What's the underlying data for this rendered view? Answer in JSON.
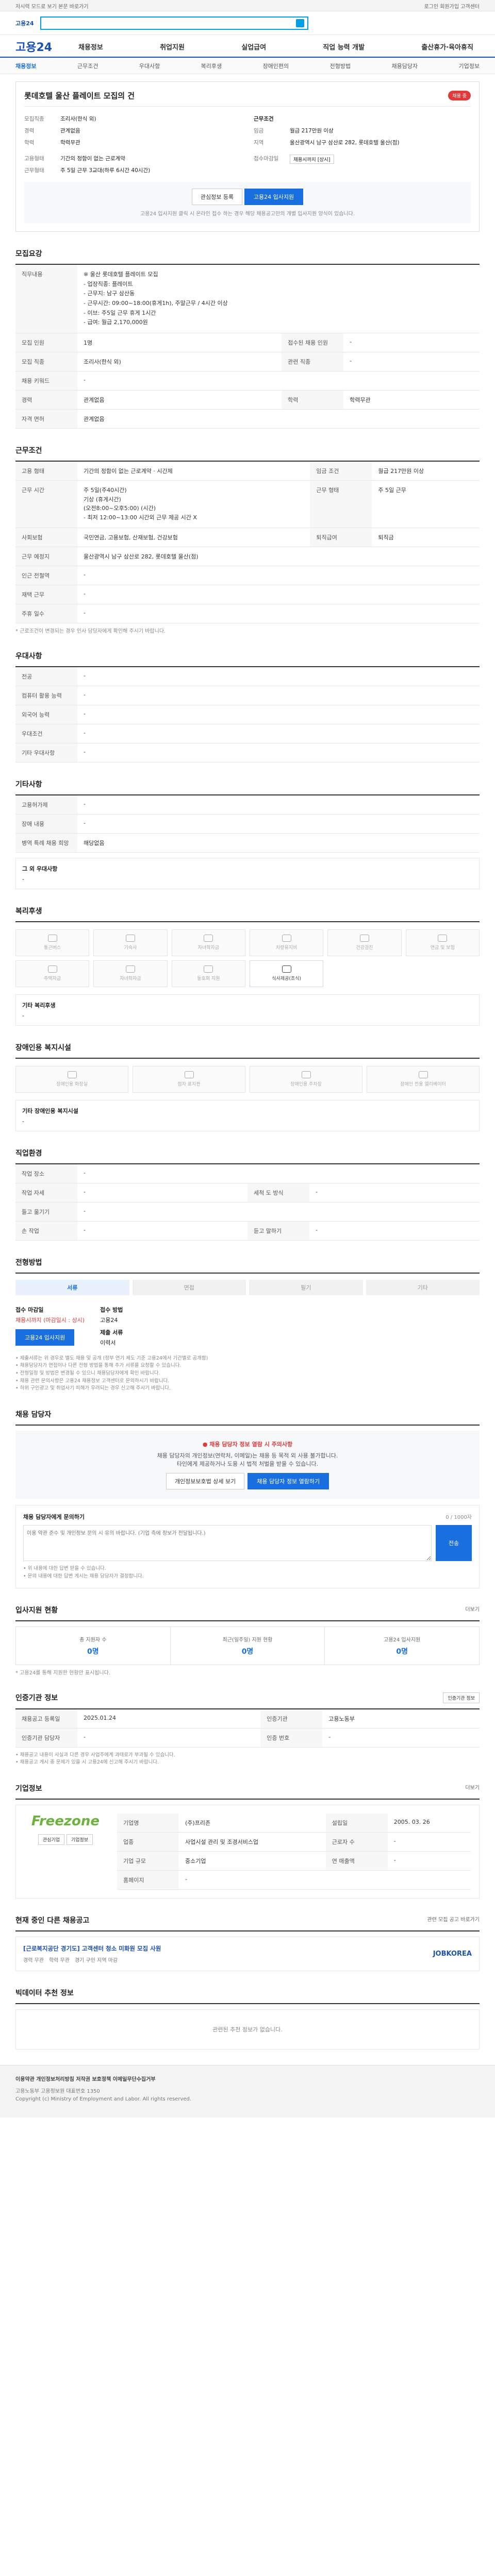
{
  "topbar": {
    "text": "저시력 모드로 보기  본문 바로가기",
    "right": "로그인  회원가입  고객센터"
  },
  "search": {
    "placeholder": "",
    "button": "검색"
  },
  "header": {
    "logo": "고용24",
    "menu": [
      "채용정보",
      "취업지원",
      "실업급여",
      "직업 능력 개발",
      "출산휴가·육아휴직"
    ]
  },
  "subnav": [
    "채용정보",
    "근무조건",
    "우대사항",
    "복리후생",
    "장애인편의",
    "전형방법",
    "채용담당자",
    "기업정보"
  ],
  "job": {
    "title": "롯데호텔 울산 플레이트 모집의 건",
    "badge": "채용 중",
    "rows": [
      {
        "k": "모집직종",
        "v": "조리사(한식 외)"
      },
      {
        "k": "경력",
        "v": "관계없음"
      },
      {
        "k": "학력",
        "v": "학력무관"
      }
    ],
    "rows_right": [
      {
        "k": "근무조건",
        "v": ""
      },
      {
        "k": "임금",
        "v": "월급 217만원 이상"
      },
      {
        "k": "지역",
        "v": "울산광역시 남구 삼산로 282, 롯데호텔 울산(점)"
      }
    ],
    "form": {
      "k": "고용형태",
      "v": "기간의 정함이 없는 근로계약"
    },
    "hours": {
      "k": "근무형태",
      "v": "주 5일 근무 3교대(하루 6시간 40시간)"
    },
    "deadline_label": "접수마감일",
    "deadline": "채용시까지 [상시]",
    "save_btn": "관심정보 등록",
    "apply_btn": "고용24 입사지원",
    "note": "고용24 입사지원 클릭 시 온라인 접수 하는 경우 해당 채용공고만의 개별 입사지원 양식이 있습니다."
  },
  "recruit": {
    "title": "모집요강",
    "duty_label": "직무내용",
    "duty": "※ 울산 롯데호텔 플레이트 모집\n- 업장직종: 플레이트\n- 근무지: 남구 삼산동\n- 근무시간: 09:00~18:00(휴게1h), 주말근무 / 4시간 이상\n- 이브: 주5일 근무 휴게 1시간\n- 급여: 월급 2,170,000원",
    "fields": [
      {
        "k": "모집 인원",
        "v": "1명",
        "k2": "접수된 채용 인원",
        "v2": "-"
      },
      {
        "k": "모집 직종",
        "v": "조리사(한식 외)",
        "k2": "관련 직종",
        "v2": "-"
      },
      {
        "k": "채용 키워드",
        "v": "-",
        "k2": "",
        "v2": ""
      },
      {
        "k": "경력",
        "v": "관계없음",
        "k2": "학력",
        "v2": "학력무관"
      },
      {
        "k": "자격 면허",
        "v": "관계없음",
        "k2": "",
        "v2": ""
      }
    ]
  },
  "conditions": {
    "title": "근무조건",
    "rows": [
      {
        "k": "고용 형태",
        "v": "기간의 정함이 없는 근로계약 · 시간제",
        "k2": "임금 조건",
        "v2": "월급 217만원 이상"
      },
      {
        "k": "근무 시간",
        "v": "주 5일(주40시간)\n기상 (휴게시간)\n(오전8:00~오후5:00) (시간)\n  - 최저 12:00~13:00 시간외 근무 제공 시간 X",
        "k2": "근무 형태",
        "v2": "주 5일 근무"
      },
      {
        "k": "사회보험",
        "v": "국민연금, 고용보험, 산재보험, 건강보험",
        "k2": "퇴직급여",
        "v2": "퇴직금"
      },
      {
        "k": "근무 예정지",
        "v": "울산광역시 남구 삼산로 282, 롯데호텔 울산(점)",
        "k2": "",
        "v2": ""
      },
      {
        "k": "인근 전철역",
        "v": "-",
        "k2": "",
        "v2": ""
      },
      {
        "k": "재택 근무",
        "v": "-",
        "k2": "",
        "v2": ""
      },
      {
        "k": "주휴 일수",
        "v": "-",
        "k2": "",
        "v2": ""
      }
    ],
    "note": "* 근로조건이 변경되는 경우 인사 담당자에게 확인해 주시기 바랍니다."
  },
  "preference": {
    "title": "우대사항",
    "rows": [
      {
        "k": "전공",
        "v": "-"
      },
      {
        "k": "컴퓨터 활용 능력",
        "v": "-"
      },
      {
        "k": "외국어 능력",
        "v": "-"
      },
      {
        "k": "우대조건",
        "v": "-"
      },
      {
        "k": "기타 우대사항",
        "v": "-"
      }
    ]
  },
  "other": {
    "title": "기타사항",
    "rows": [
      {
        "k": "고용허가제",
        "v": "-"
      },
      {
        "k": "장애 내용",
        "v": "-"
      },
      {
        "k": "병역 특례 채용 희망",
        "v": "해당없음"
      }
    ],
    "extra_label": "그 외 우대사항",
    "extra": "-"
  },
  "welfare": {
    "title": "복리후생",
    "items": [
      "통근버스",
      "기숙사",
      "자녀학자금",
      "차량유지비",
      "건강검진",
      "연금 및 보험",
      "주택자금",
      "자녀학자금",
      "동호회 지원",
      "식사제공(조식)"
    ],
    "active": 9,
    "extra_label": "기타 복리후생",
    "extra": "-"
  },
  "accessibility": {
    "title": "장애인용 복지시설",
    "items": [
      "장애인용 화장실",
      "점자 표지판",
      "장애인용 주차장",
      "장애인 전용 엘리베이터"
    ],
    "extra_label": "기타 장애인용 복지시설",
    "extra": "-"
  },
  "workplace": {
    "title": "직업환경",
    "rows": [
      {
        "k": "작업 장소",
        "v": "-",
        "k2": "",
        "v2": ""
      },
      {
        "k": "작업 자세",
        "v": "-",
        "k2": "세척 도 방식",
        "v2": "-"
      },
      {
        "k": "들고 옮기기",
        "v": "-",
        "k2": "",
        "v2": ""
      },
      {
        "k": "손 작업",
        "v": "-",
        "k2": "듣고 말하기",
        "v2": "-"
      }
    ]
  },
  "selection": {
    "title": "전형방법",
    "steps": [
      "서류",
      "면접",
      "필기",
      "기타"
    ],
    "active": 0,
    "deadline_label": "접수 마감일",
    "deadline": "채용시까지 (마감일시 : 상시)",
    "method_label": "접수 방법",
    "method": "고용24",
    "docs_label": "제출 서류",
    "docs": "이력서",
    "apply_btn": "고용24 입사지원",
    "notes": [
      "• 제출서류는 위 경우로 별도 채용 및 공개 (정부 연기 제도 기준 고용24에서 기간별로 공개함)",
      "• 채용담당자가 면접이나 다른 전형 방법을 통해 추가 서류를 요청할 수 있습니다.",
      "• 전형일정 및 방법은 변경될 수 있으니 채용담당자에게 확인 바랍니다.",
      "• 채용 관련 문의사항은 고용24 채용정보 고객센터로 문의하시기 바랍니다.",
      "• 허위 구인광고 및 취업사기 피해가 우려되는 경우 신고해 주시기 바랍니다."
    ]
  },
  "contact": {
    "title": "채용 담당자",
    "warn": "채용 담당자 정보 열람 시 주의사항",
    "warn_text": "채용 담당자의 개인정보(연락처, 이메일)는 채용 등 목적 외 사용 불가합니다.",
    "warn_text2": "타인에게 제공하거나 도용 시 법적 처벌을 받을 수 있습니다.",
    "btn_agree": "개인정보보호법 상세 보기",
    "btn_show": "채용 담당자 정보 열람하기",
    "inquiry_title": "채용 담당자에게 문의하기",
    "inquiry_note": "0 / 1000자",
    "inquiry_placeholder": "이용 약관 준수 및 개인정보 문의 시 유의 바랍니다. (기업 측에 정보가 전달됩니다.)",
    "inquiry_btn": "전송",
    "notes": [
      "• 위 내용에 대한 답변 받을 수 있습니다.",
      "• 문의 내용에 대한 답변 게시는 채용 담당자가 결정합니다."
    ]
  },
  "stats": {
    "title": "입사지원 현황",
    "more": "더보기",
    "items": [
      {
        "label": "총 지원자 수",
        "value": "0명"
      },
      {
        "label": "최근(일주일) 지원 현황",
        "value": "0명"
      },
      {
        "label": "고용24 입사지원",
        "value": "0명"
      }
    ],
    "note": "* 고용24를 통해 지원한 현황만 표시됩니다."
  },
  "posting": {
    "title": "인증기관 정보",
    "badge_btn": "인증기관 정보",
    "rows": [
      {
        "k": "채용공고 등록일",
        "v": "2025.01.24",
        "k2": "인증기관",
        "v2": "고용노동부"
      },
      {
        "k": "인증기관 담당자",
        "v": "-",
        "k2": "인증 번호",
        "v2": "-"
      }
    ],
    "notes": [
      "• 채용공고 내용이 사실과 다른 경우 사업주에게 과태료가 부과될 수 있습니다.",
      "• 채용공고 게시 중 문제가 있을 시 고용24에 신고해 주시기 바랍니다."
    ]
  },
  "company": {
    "title": "기업정보",
    "more": "더보기",
    "logo_text": "Freezone",
    "btn1": "관심기업",
    "btn2": "기업정보",
    "rows": [
      {
        "k": "기업명",
        "v": "(주)프리존",
        "k2": "설립일",
        "v2": "2005. 03. 26"
      },
      {
        "k": "업종",
        "v": "사업시설 관리 및 조경서비스업",
        "k2": "근로자 수",
        "v2": "-"
      },
      {
        "k": "기업 규모",
        "v": "중소기업",
        "k2": "연 매출액",
        "v2": "-"
      },
      {
        "k": "홈페이지",
        "v": "-",
        "k2": "",
        "v2": ""
      }
    ]
  },
  "related": {
    "title": "현재 중인 다른 채용공고",
    "more": "관련 모집 공고 바로가기",
    "item_title": "[근로복지공단 경기도] 고객센터 청소 미화원 모집 사원",
    "item_meta": [
      "경력 무관",
      "학력 무관",
      "경기 구인 지역 마감"
    ],
    "item_company": "JOBKOREA"
  },
  "recommend": {
    "title": "빅데이터 추천 정보",
    "empty": "관련된 추천 정보가 없습니다."
  },
  "footer": {
    "links": "이용약관  개인정보처리방침  저작권 보호정책  이메일무단수집거부",
    "addr": "고용노동부 고용정보원  대표번호 1350",
    "copy": "Copyright (c) Ministry of Employment and Labor. All rights reserved."
  },
  "colors": {
    "accent": "#1a6fe0",
    "brand": "#1a4fb4",
    "badge": "#e03a3a"
  }
}
